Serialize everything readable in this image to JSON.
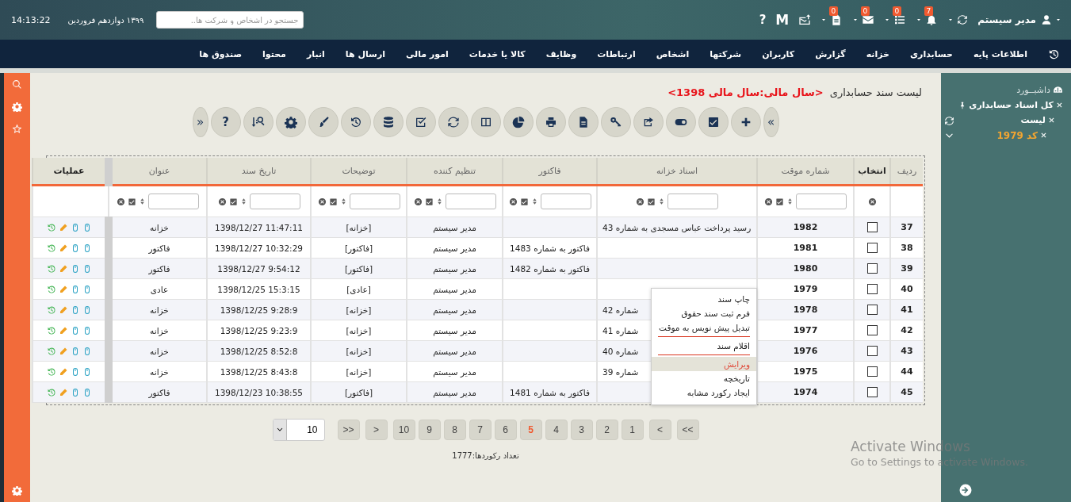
{
  "header": {
    "user_name": "مدیر سیستم",
    "notifications": [
      {
        "kind": "bell",
        "count": "7"
      },
      {
        "kind": "list",
        "count": "0"
      },
      {
        "kind": "envelope",
        "count": "0"
      },
      {
        "kind": "file",
        "count": "0"
      }
    ],
    "logo_letter": "M",
    "help": "?",
    "search": {
      "placeholder": "جستجو در اشخاص و شرکت ها.."
    },
    "date": "۱۳۹۹ دوازدهم فروردین",
    "time": "14:13:22"
  },
  "nav": {
    "items": [
      "اطلاعات پایه",
      "حسابداری",
      "خزانه",
      "گزارش",
      "کاربران",
      "شرکتها",
      "اشخاص",
      "ارتباطات",
      "وظایف",
      "کالا یا خدمات",
      "امور مالی",
      "ارسال ها",
      "انبار",
      "محتوا",
      "صندوق ها"
    ]
  },
  "sidebar": {
    "tree": [
      {
        "label": "داشبــورد",
        "kind": "dashboard",
        "selected": false
      },
      {
        "label": "کل اسناد حسابداری",
        "kind": "pinned",
        "selected": false,
        "children": [
          {
            "label": "لیست",
            "kind": "tab",
            "selected": false,
            "children": [
              {
                "label": "کد 1979",
                "kind": "tab",
                "selected": true
              }
            ]
          }
        ]
      }
    ]
  },
  "page": {
    "title": "لیست سند حسابداری",
    "fiscal_year": "<سال مالی:سال مالی 1398>"
  },
  "toolbar": {
    "expand": "»",
    "help": "?",
    "collapse": "«"
  },
  "table": {
    "columns": [
      {
        "label": "ردیف",
        "kind": "index"
      },
      {
        "label": "انتخاب",
        "kind": "select"
      },
      {
        "label": "شماره موقت",
        "kind": "data"
      },
      {
        "label": "اسناد خزانه",
        "kind": "data"
      },
      {
        "label": "فاکتور",
        "kind": "data"
      },
      {
        "label": "تنظیم کننده",
        "kind": "data"
      },
      {
        "label": "توضیحات",
        "kind": "data"
      },
      {
        "label": "تاریخ سند",
        "kind": "data"
      },
      {
        "label": "عنوان",
        "kind": "data"
      },
      {
        "label": "عملیات",
        "kind": "actions"
      }
    ],
    "rows": [
      {
        "cells": [
          "37",
          "",
          "1982",
          "رسید پرداخت عباس مسجدی به شماره 43",
          "",
          "مدیر سیستم",
          "[خزانه]",
          "11:47:11 1398/12/27",
          "خزانه"
        ],
        "checked": false
      },
      {
        "cells": [
          "38",
          "",
          "1981",
          "",
          "فاکتور به شماره 1483",
          "مدیر سیستم",
          "[فاکتور]",
          "10:32:29 1398/12/27",
          "فاکتور"
        ],
        "checked": false
      },
      {
        "cells": [
          "39",
          "",
          "1980",
          "",
          "فاکتور به شماره 1482",
          "مدیر سیستم",
          "[فاکتور]",
          "9:54:12 1398/12/27",
          "فاکتور"
        ],
        "checked": false
      },
      {
        "cells": [
          "40",
          "",
          "1979",
          "",
          "",
          "مدیر سیستم",
          "[عادی]",
          "15:3:15 1398/12/25",
          "عادی"
        ],
        "checked": false
      },
      {
        "cells": [
          "41",
          "",
          "1978",
          "شماره 42",
          "",
          "مدیر سیستم",
          "[خزانه]",
          "9:28:9 1398/12/25",
          "خزانه"
        ],
        "checked": false
      },
      {
        "cells": [
          "42",
          "",
          "1977",
          "شماره 41",
          "",
          "مدیر سیستم",
          "[خزانه]",
          "9:23:9 1398/12/25",
          "خزانه"
        ],
        "checked": false
      },
      {
        "cells": [
          "43",
          "",
          "1976",
          "شماره 40",
          "",
          "مدیر سیستم",
          "[خزانه]",
          "8:52:8 1398/12/25",
          "خزانه"
        ],
        "checked": false
      },
      {
        "cells": [
          "44",
          "",
          "1975",
          "شماره 39",
          "",
          "مدیر سیستم",
          "[خزانه]",
          "8:43:8 1398/12/25",
          "خزانه"
        ],
        "checked": false
      },
      {
        "cells": [
          "45",
          "",
          "1974",
          "",
          "فاکتور به شماره 1481",
          "مدیر سیستم",
          "[فاکتور]",
          "10:38:55 1398/12/23",
          "فاکتور"
        ],
        "checked": false
      }
    ]
  },
  "context_menu": {
    "items": [
      {
        "kind": "item",
        "label": "چاپ سند",
        "selected": false
      },
      {
        "kind": "item",
        "label": "فرم ثبت سند حقوق",
        "selected": false
      },
      {
        "kind": "item",
        "label": "تبدیل پیش نویس به موقت",
        "selected": false
      },
      {
        "kind": "separator"
      },
      {
        "kind": "item",
        "label": "اقلام سند",
        "selected": false
      },
      {
        "kind": "separator"
      },
      {
        "kind": "item",
        "label": "ویرایش",
        "selected": true
      },
      {
        "kind": "item",
        "label": "تاریخچه",
        "selected": false
      },
      {
        "kind": "item",
        "label": "ایجاد رکورد مشابه",
        "selected": false
      }
    ]
  },
  "pagination": {
    "buttons": [
      {
        "label": ">>",
        "selected": false
      },
      {
        "label": ">",
        "selected": false
      },
      {
        "label": "1",
        "selected": false
      },
      {
        "label": "2",
        "selected": false
      },
      {
        "label": "3",
        "selected": false
      },
      {
        "label": "4",
        "selected": false
      },
      {
        "label": "5",
        "selected": true
      },
      {
        "label": "6",
        "selected": false
      },
      {
        "label": "7",
        "selected": false
      },
      {
        "label": "8",
        "selected": false
      },
      {
        "label": "9",
        "selected": false
      },
      {
        "label": "10",
        "selected": false
      },
      {
        "label": "<",
        "selected": false
      },
      {
        "label": "<<",
        "selected": false
      }
    ],
    "page_size": "10",
    "record_count": "تعداد رکوردها:1777"
  },
  "os_notice": {
    "title": "Activate Windows",
    "text": "Go to Settings to activate Windows."
  }
}
